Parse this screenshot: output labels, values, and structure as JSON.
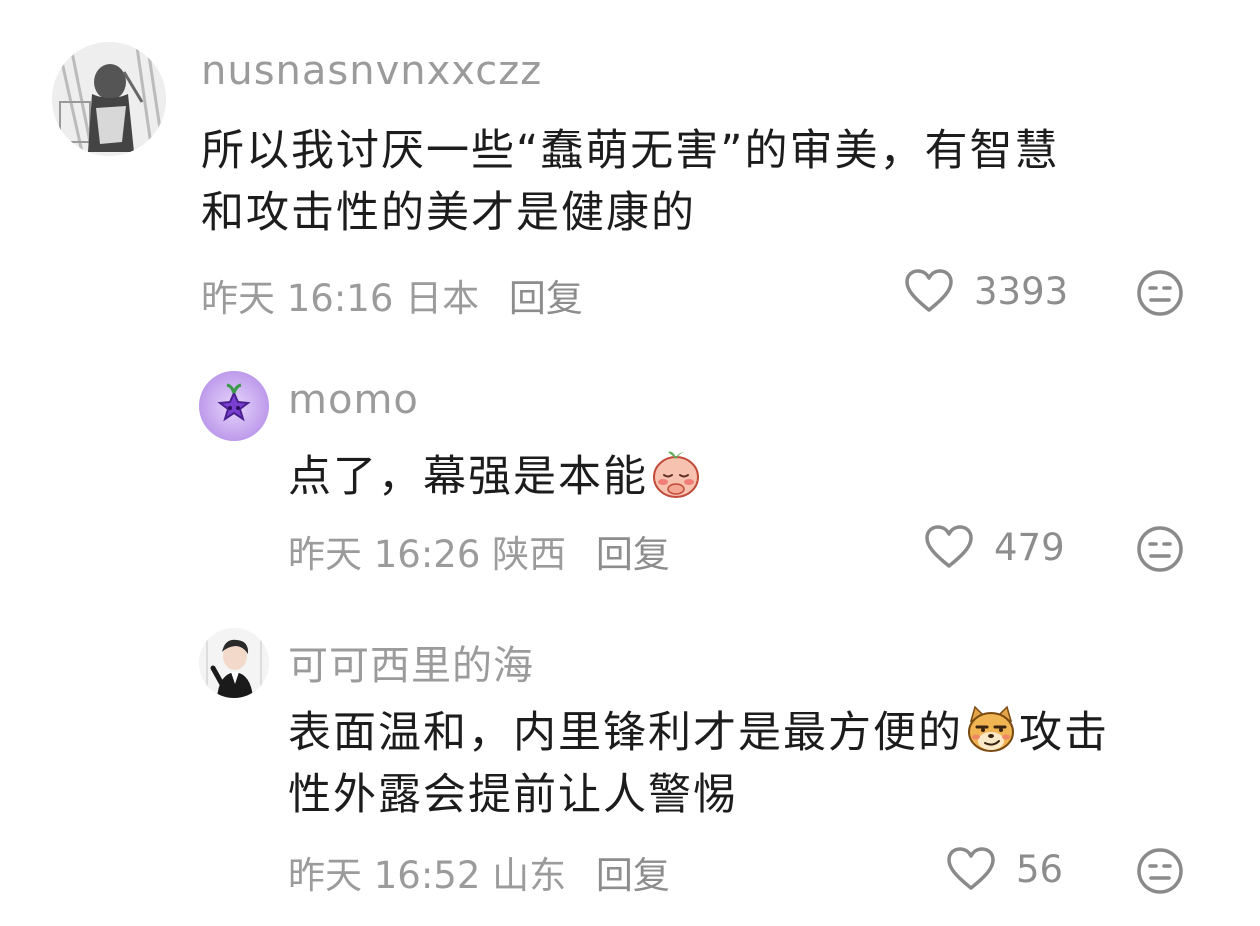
{
  "comments": [
    {
      "username": "nusnasnvnxxczz",
      "content_lines": [
        "所以我讨厌一些“蠢萌无害”的审美，有智慧",
        "和攻击性的美才是健康的"
      ],
      "time": "昨天 16:16",
      "location": "日本",
      "reply_label": "回复",
      "likes": "3393",
      "avatar_icon": "avatar-sketch-person",
      "dislike_icon": "neutral-face-icon"
    },
    {
      "username": "momo",
      "content_text": "点了，幕强是本能",
      "content_emoji": "blushing-peach-emoji",
      "time": "昨天 16:26",
      "location": "陕西",
      "reply_label": "回复",
      "likes": "479",
      "avatar_icon": "avatar-purple-star",
      "dislike_icon": "neutral-face-icon"
    },
    {
      "username": "可可西里的海",
      "content_line1_a": "表面温和，内里锋利才是最方便的",
      "content_emoji": "smirking-dog-emoji",
      "content_line1_b": "攻击",
      "content_line2": "性外露会提前让人警惕",
      "time": "昨天 16:52",
      "location": "山东",
      "reply_label": "回复",
      "likes": "56",
      "avatar_icon": "avatar-man-portrait",
      "dislike_icon": "neutral-face-icon"
    }
  ],
  "colors": {
    "text_primary": "#1c1c1c",
    "text_secondary": "#9b9b9b",
    "icon_stroke": "#8a8a8a",
    "momo_avatar_purple": "#b58ee8"
  }
}
